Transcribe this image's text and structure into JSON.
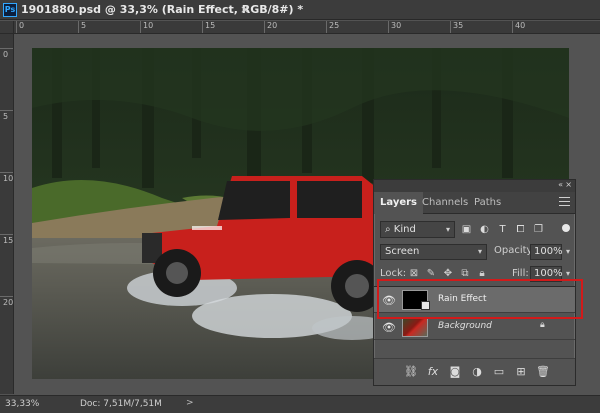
{
  "title_bar": {
    "app_logo": "Ps",
    "document_title": "1901880.psd @ 33,3% (Rain Effect, RGB/8#) *",
    "close_glyph": "×"
  },
  "rulers": {
    "top_labels": [
      "0",
      "5",
      "10",
      "15",
      "20",
      "25",
      "30",
      "35",
      "40"
    ],
    "left_labels": [
      "0",
      "5",
      "10",
      "15",
      "20"
    ]
  },
  "status_bar": {
    "zoom": "33,33%",
    "doc_info": "Doc: 7,51M/7,51M",
    "arrow": ">"
  },
  "layers_panel": {
    "collapse_glyph": "«",
    "close_glyph": "×",
    "tabs": [
      {
        "label": "Layers",
        "active": true
      },
      {
        "label": "Channels",
        "active": false
      },
      {
        "label": "Paths",
        "active": false
      }
    ],
    "filter": {
      "kind_label": "Kind",
      "icons": [
        "image-filter-icon",
        "adjustment-filter-icon",
        "type-filter-icon",
        "shape-filter-icon",
        "smart-object-filter-icon"
      ]
    },
    "blend_mode": "Screen",
    "opacity_label": "Opacity:",
    "opacity_value": "100%",
    "lock_label": "Lock:",
    "fill_label": "Fill:",
    "fill_value": "100%",
    "layers": [
      {
        "name": "Rain Effect",
        "selected": true,
        "visible": true,
        "italic": false,
        "locked": false
      },
      {
        "name": "Background",
        "selected": false,
        "visible": true,
        "italic": true,
        "locked": true
      }
    ],
    "bottom_icons": [
      "link-layers-icon",
      "fx-icon",
      "add-mask-icon",
      "adjustment-layer-icon",
      "new-group-icon",
      "new-layer-icon",
      "trash-icon"
    ]
  },
  "colors": {
    "highlight": "#d21a1a",
    "jeep_red": "#c8201c",
    "ps_blue": "#31a8ff"
  }
}
